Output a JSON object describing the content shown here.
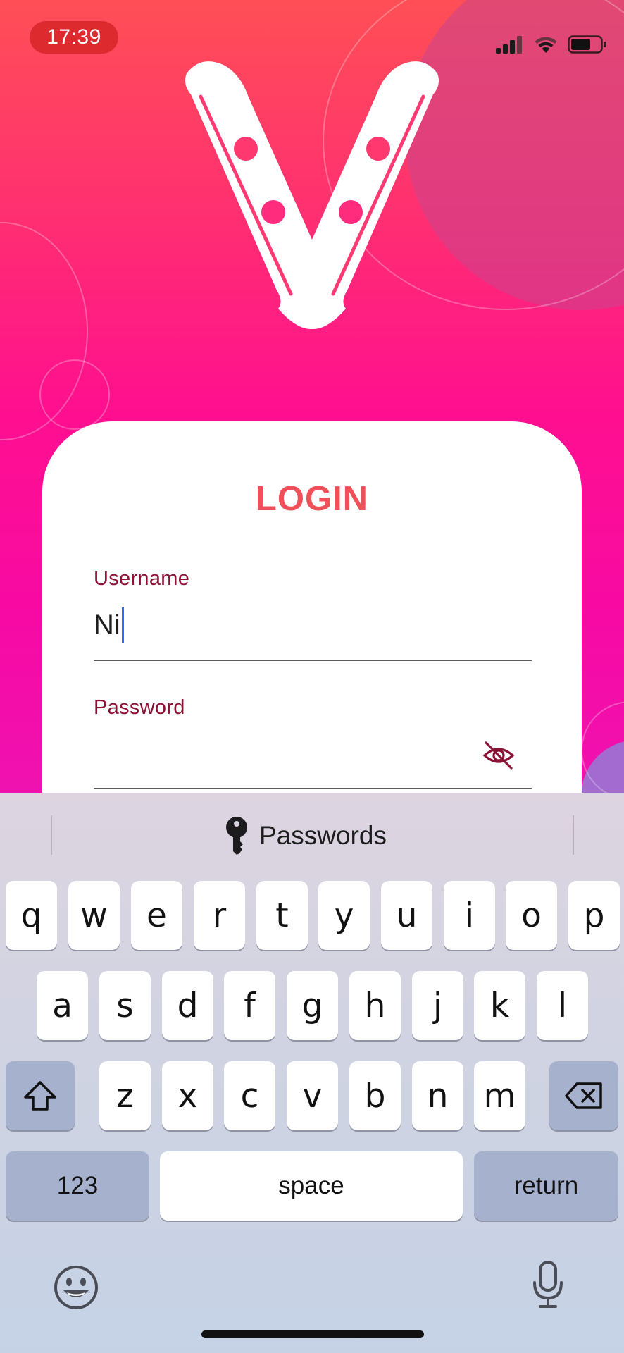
{
  "status_bar": {
    "time": "17:39",
    "icons": [
      "signal-icon",
      "wifi-icon",
      "battery-icon"
    ]
  },
  "login": {
    "title": "LOGIN",
    "username_label": "Username",
    "username_value": "Ni",
    "password_label": "Password",
    "password_value": "",
    "toggle_icon": "eye-off-icon"
  },
  "keyboard": {
    "suggestion_label": "Passwords",
    "suggestion_icon": "key-icon",
    "row1": [
      "q",
      "w",
      "e",
      "r",
      "t",
      "y",
      "u",
      "i",
      "o",
      "p"
    ],
    "row2": [
      "a",
      "s",
      "d",
      "f",
      "g",
      "h",
      "j",
      "k",
      "l"
    ],
    "row3": [
      "z",
      "x",
      "c",
      "v",
      "b",
      "n",
      "m"
    ],
    "numbers_label": "123",
    "space_label": "space",
    "return_label": "return",
    "shift_icon": "shift-icon",
    "delete_icon": "backspace-icon",
    "emoji_icon": "emoji-icon",
    "dictation_icon": "microphone-icon"
  },
  "colors": {
    "accent_title": "#f0505a",
    "label_color": "#8c1235",
    "caret": "#2f6bff"
  }
}
